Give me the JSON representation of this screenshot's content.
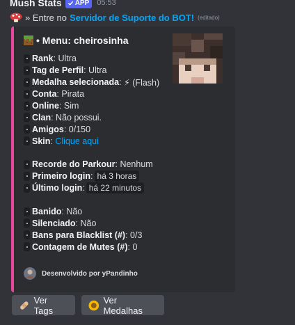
{
  "header": {
    "bot_name": "Mush Stats",
    "app_badge": "APP",
    "timestamp": "05:53"
  },
  "reply": {
    "prefix": "» Entre no",
    "link": "Servidor de Suporte do BOT!",
    "edited": "(editado)"
  },
  "embed": {
    "accent_color": "#eb459e",
    "title": "• Menu: cheirosinha",
    "fields": [
      {
        "label": "Rank",
        "value": "Ultra"
      },
      {
        "label": "Tag de Perfil",
        "value": "Ultra"
      },
      {
        "label": "Medalha selecionada",
        "value": "⚡ (Flash)"
      },
      {
        "label": "Conta",
        "value": "Pirata"
      },
      {
        "label": "Online",
        "value": "Sim"
      },
      {
        "label": "Clan",
        "value": "Não possui."
      },
      {
        "label": "Amigos",
        "value": "0/150"
      },
      {
        "label": "Skin",
        "link": "Clique aqui"
      },
      {
        "label": "Recorde do Parkour",
        "value": "Nenhum"
      },
      {
        "label": "Primeiro login",
        "code": "há 3 horas"
      },
      {
        "label": "Último login",
        "code": "há 22 minutos"
      },
      {
        "label": "Banido",
        "value": "Não"
      },
      {
        "label": "Silenciado",
        "value": "Não"
      },
      {
        "label": "Bans para Blacklist (#)",
        "value": "0/3"
      },
      {
        "label": "Contagem de Mutes (#)",
        "value": "0"
      }
    ],
    "footer": "Desenvolvido por yPandinho"
  },
  "buttons": {
    "tags_label": "Ver Tags",
    "medals_label": "Ver Medalhas"
  }
}
